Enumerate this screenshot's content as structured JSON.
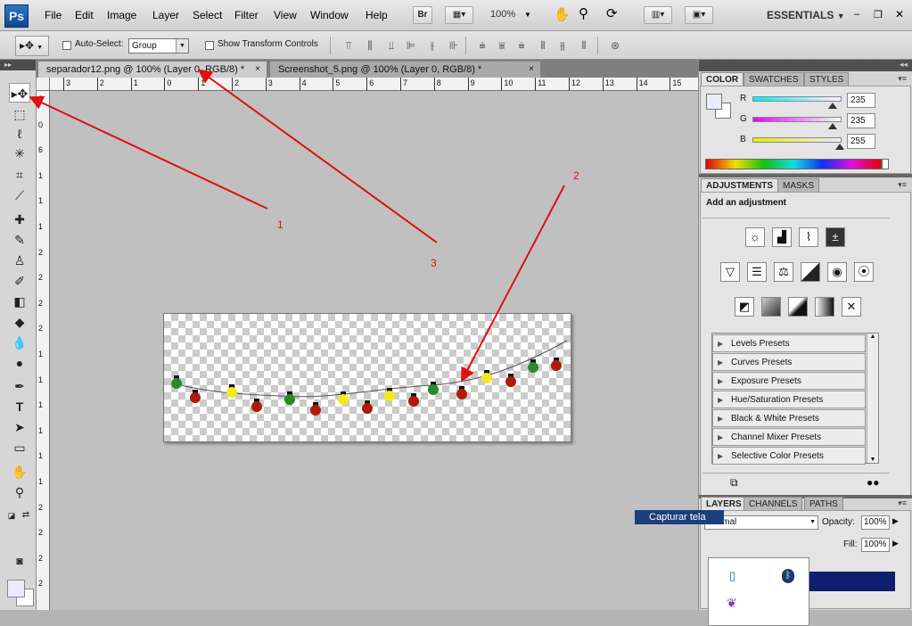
{
  "app": {
    "logo": "Ps"
  },
  "menubar": {
    "items": [
      "File",
      "Edit",
      "Image",
      "Layer",
      "Select",
      "Filter",
      "View",
      "Window",
      "Help"
    ],
    "bridge_label": "Br",
    "zoom": "100%",
    "workspace": "ESSENTIALS"
  },
  "options": {
    "auto_select_label": "Auto-Select:",
    "auto_select_value": "Group",
    "show_transform_label": "Show Transform Controls"
  },
  "documents": {
    "tabs": [
      {
        "label": "separador12.png @ 100% (Layer 0, RGB/8) *"
      },
      {
        "label": "Screenshot_5.png @ 100% (Layer 0, RGB/8) *"
      }
    ],
    "close_glyph": "×"
  },
  "ruler": {
    "h_labels": [
      "3",
      "2",
      "1",
      "0",
      "1",
      "2",
      "3",
      "4",
      "5",
      "6",
      "7",
      "8",
      "9",
      "10",
      "11",
      "12",
      "13",
      "14",
      "15"
    ],
    "v_labels": [
      "0",
      "0",
      "6",
      "1",
      "1",
      "1",
      "2",
      "2",
      "2",
      "2",
      "1",
      "1",
      "1",
      "1",
      "1",
      "1",
      "2",
      "2",
      "2",
      "2"
    ]
  },
  "annotations": [
    "1",
    "2",
    "3"
  ],
  "lights": {
    "colors": [
      "#2a8a2a",
      "#b01a0a",
      "#f2ea1a"
    ]
  },
  "color_panel": {
    "tabs": [
      "COLOR",
      "SWATCHES",
      "STYLES"
    ],
    "channels": [
      {
        "label": "R",
        "value": "235"
      },
      {
        "label": "G",
        "value": "235"
      },
      {
        "label": "B",
        "value": "255"
      }
    ],
    "fg_color": "#ebebff"
  },
  "adjustments_panel": {
    "tabs": [
      "ADJUSTMENTS",
      "MASKS"
    ],
    "heading": "Add an adjustment",
    "presets": [
      "Levels Presets",
      "Curves Presets",
      "Exposure Presets",
      "Hue/Saturation Presets",
      "Black & White Presets",
      "Channel Mixer Presets",
      "Selective Color Presets"
    ]
  },
  "layers_panel": {
    "tabs": [
      "LAYERS",
      "CHANNELS",
      "PATHS"
    ],
    "blend_mode": "Normal",
    "opacity_label": "Opacity:",
    "opacity_value": "100%",
    "fill_label": "Fill:",
    "fill_value": "100%"
  },
  "tooltip": {
    "text": "Capturar tela"
  }
}
